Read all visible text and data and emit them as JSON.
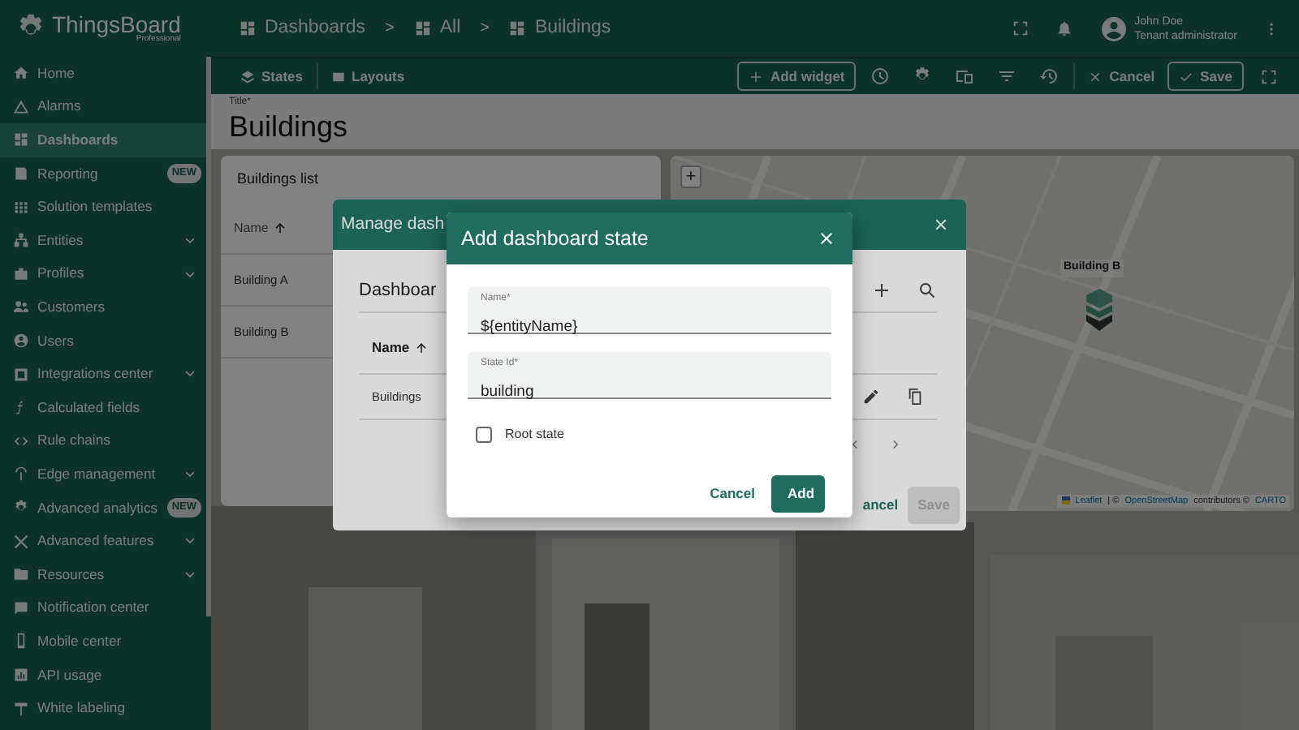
{
  "header": {
    "logo": {
      "name": "ThingsBoard",
      "edition": "Professional"
    },
    "breadcrumbs": [
      {
        "label": "Dashboards"
      },
      {
        "label": "All"
      },
      {
        "label": "Buildings"
      }
    ],
    "separator": ">",
    "user": {
      "name": "John Doe",
      "role": "Tenant administrator"
    }
  },
  "sidebar": {
    "items": [
      {
        "label": "Home",
        "selected": false,
        "expandable": false
      },
      {
        "label": "Alarms",
        "selected": false,
        "expandable": false
      },
      {
        "label": "Dashboards",
        "selected": true,
        "expandable": false
      },
      {
        "label": "Reporting",
        "selected": false,
        "expandable": false,
        "badge": "NEW"
      },
      {
        "label": "Solution templates",
        "selected": false,
        "expandable": false
      },
      {
        "label": "Entities",
        "selected": false,
        "expandable": true
      },
      {
        "label": "Profiles",
        "selected": false,
        "expandable": true
      },
      {
        "label": "Customers",
        "selected": false,
        "expandable": false
      },
      {
        "label": "Users",
        "selected": false,
        "expandable": false
      },
      {
        "label": "Integrations center",
        "selected": false,
        "expandable": true
      },
      {
        "label": "Calculated fields",
        "selected": false,
        "expandable": false
      },
      {
        "label": "Rule chains",
        "selected": false,
        "expandable": false
      },
      {
        "label": "Edge management",
        "selected": false,
        "expandable": true
      },
      {
        "label": "Advanced analytics",
        "selected": false,
        "expandable": false,
        "badge": "NEW"
      },
      {
        "label": "Advanced features",
        "selected": false,
        "expandable": true
      },
      {
        "label": "Resources",
        "selected": false,
        "expandable": true
      },
      {
        "label": "Notification center",
        "selected": false,
        "expandable": false
      },
      {
        "label": "Mobile center",
        "selected": false,
        "expandable": false
      },
      {
        "label": "API usage",
        "selected": false,
        "expandable": false
      },
      {
        "label": "White labeling",
        "selected": false,
        "expandable": false
      }
    ]
  },
  "toolbar": {
    "tabs": [
      {
        "label": "States"
      },
      {
        "label": "Layouts"
      }
    ],
    "add_widget": "Add widget",
    "cancel": "Cancel",
    "save": "Save"
  },
  "title_field": {
    "label": "Title*",
    "value": "Buildings"
  },
  "widgets": {
    "list": {
      "title": "Buildings list",
      "column": "Name",
      "rows": [
        "Building A",
        "Building B"
      ]
    },
    "map": {
      "zoom_in": "+",
      "marker_label": "Building B",
      "attribution": [
        {
          "kind": "link",
          "text": "Leaflet"
        },
        {
          "kind": "text",
          "text": " | © "
        },
        {
          "kind": "link",
          "text": "OpenStreetMap"
        },
        {
          "kind": "text",
          "text": " contributors © "
        },
        {
          "kind": "link",
          "text": "CARTO"
        }
      ]
    }
  },
  "manage_dialog": {
    "title": "Manage dash",
    "heading": "Dashboar",
    "column": "Name",
    "rows": [
      "Buildings"
    ],
    "buttons": [
      {
        "label": "ancel",
        "disabled": false
      },
      {
        "label": "Save",
        "disabled": true
      }
    ]
  },
  "add_dialog": {
    "title": "Add dashboard state",
    "fields": [
      {
        "label": "Name*",
        "value": "${entityName}"
      },
      {
        "label": "State Id*",
        "value": "building"
      }
    ],
    "root_state": {
      "label": "Root state",
      "checked": false
    },
    "buttons": [
      {
        "label": "Cancel",
        "kind": "text"
      },
      {
        "label": "Add",
        "kind": "primary"
      }
    ]
  }
}
